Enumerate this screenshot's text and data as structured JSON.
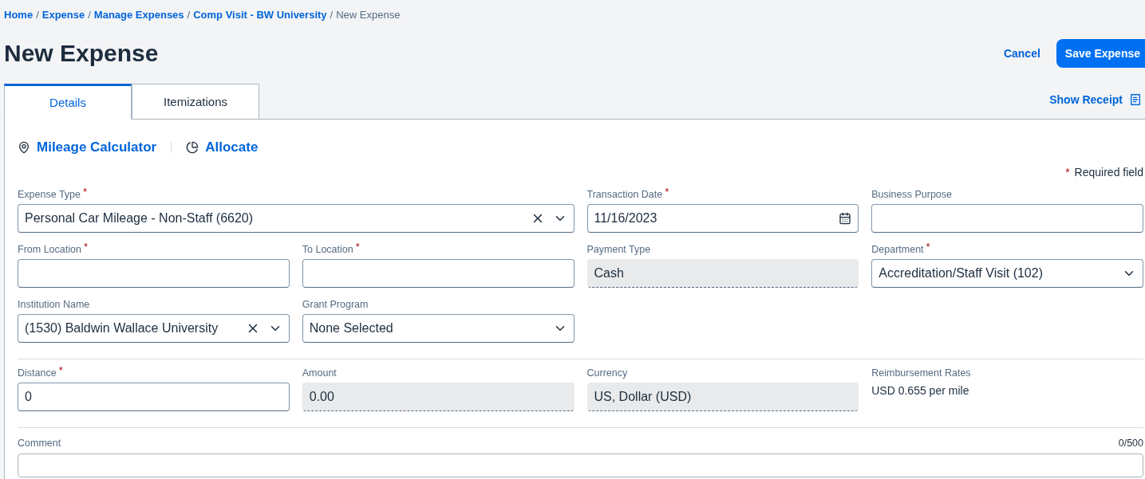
{
  "breadcrumb": [
    {
      "label": "Home",
      "link": true
    },
    {
      "label": "Expense",
      "link": true
    },
    {
      "label": "Manage Expenses",
      "link": true
    },
    {
      "label": "Comp Visit - BW University",
      "link": true
    },
    {
      "label": "New Expense",
      "link": false
    }
  ],
  "breadcrumb_separator": "/",
  "required_marker": "*",
  "title": "New Expense",
  "header_actions": {
    "cancel": "Cancel",
    "save": "Save Expense"
  },
  "tabs": [
    {
      "label": "Details",
      "selected": true
    },
    {
      "label": "Itemizations",
      "selected": false
    }
  ],
  "show_receipt": "Show Receipt",
  "tools": [
    {
      "label": "Mileage Calculator",
      "kind": "pin"
    },
    {
      "label": "Allocate",
      "kind": "pie"
    }
  ],
  "required_note": "Required field",
  "sections": [
    {
      "fields": [
        {
          "label": "Expense Type",
          "required": true,
          "kind": "select",
          "value": "Personal Car Mileage - Non-Staff (6620)",
          "clearable": true,
          "wide": true
        },
        {
          "label": "Transaction Date",
          "required": true,
          "kind": "date",
          "value": "11/16/2023"
        },
        {
          "label": "Business Purpose",
          "required": false,
          "kind": "text"
        },
        {
          "label": "From Location",
          "required": true,
          "kind": "text"
        },
        {
          "label": "To Location",
          "required": true,
          "kind": "text"
        },
        {
          "label": "Payment Type",
          "required": false,
          "kind": "readonly",
          "value": "Cash"
        },
        {
          "label": "Department",
          "required": true,
          "kind": "select",
          "value": "Accreditation/Staff Visit (102)",
          "clearable": false
        },
        {
          "label": "Institution Name",
          "required": false,
          "kind": "select",
          "value": "(1530) Baldwin Wallace University",
          "clearable": true
        },
        {
          "label": "Grant Program",
          "required": false,
          "kind": "select",
          "value": "None Selected",
          "clearable": false
        }
      ]
    },
    {
      "fields": [
        {
          "label": "Distance",
          "required": true,
          "kind": "text",
          "value": "0"
        },
        {
          "label": "Amount",
          "required": false,
          "kind": "readonly",
          "value": "0.00"
        },
        {
          "label": "Currency",
          "required": false,
          "kind": "readonly",
          "value": "US, Dollar (USD)"
        },
        {
          "label": "Reimbursement Rates",
          "required": false,
          "kind": "info",
          "value": "USD 0.655 per mile"
        }
      ]
    }
  ],
  "comment": {
    "label": "Comment",
    "counter": "0/500"
  }
}
